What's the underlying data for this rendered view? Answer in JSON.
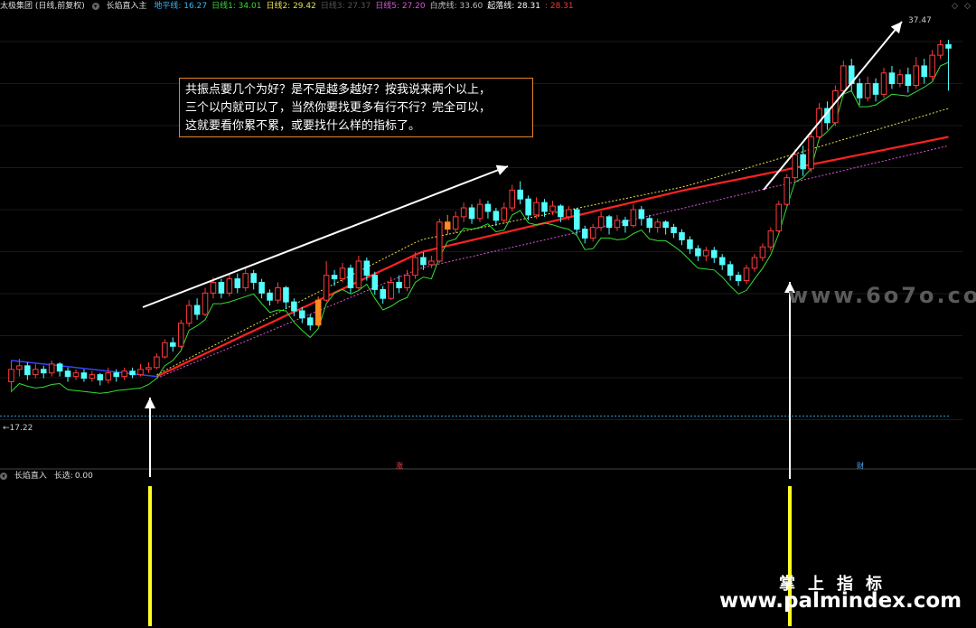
{
  "header": {
    "stock": "太极集团 (日线,前复权)",
    "indicator": "长焰直入主",
    "items": [
      {
        "label": "地平线:",
        "value": "16.27",
        "color": "#33b8ff"
      },
      {
        "label": "日线1:",
        "value": "34.01",
        "color": "#33dd33"
      },
      {
        "label": "日线2:",
        "value": "29.42",
        "color": "#e8e050"
      },
      {
        "label": "日线3:",
        "value": "27.37",
        "color": "#555555"
      },
      {
        "label": "日线5:",
        "value": "27.20",
        "color": "#dd55dd"
      },
      {
        "label": "白虎线:",
        "value": "33.60",
        "color": "#bbbbbb"
      },
      {
        "label": "起落线:",
        "value": "28.31",
        "color": "#ffffff"
      },
      {
        "label": ":",
        "value": "28.31",
        "color": "#ff3333"
      }
    ]
  },
  "sub_header": {
    "name": "长焰直入",
    "label": "长选:",
    "value": "0.00"
  },
  "annotation": {
    "lines": [
      "共振点要几个为好？是不是越多越好？按我说来两个以上，",
      "三个以内就可以了，当然你要找更多有行不行？完全可以，",
      "这就要看你累不累，或要找什么样的指标了。"
    ]
  },
  "price_labels": {
    "high": "37.47",
    "low": "17.22"
  },
  "markers": {
    "zhang": "涨",
    "cai": "财"
  },
  "watermarks": {
    "site_small": "www.6o7o.com",
    "brand": "掌上指标",
    "site": "www.palmindex.com"
  },
  "chart_data": {
    "type": "candlestick",
    "y_range": [
      14,
      39
    ],
    "reference_line": 16.27,
    "low_price": 17.22,
    "high_price": 37.47,
    "candles": [
      [
        18.2,
        18.9,
        19.4,
        17.6
      ],
      [
        18.9,
        19.1,
        19.5,
        18.5
      ],
      [
        19.1,
        18.6,
        19.3,
        18.3
      ],
      [
        18.6,
        18.9,
        19.2,
        18.4
      ],
      [
        18.9,
        18.7,
        19.1,
        18.4
      ],
      [
        18.7,
        19.2,
        19.4,
        18.5
      ],
      [
        19.2,
        18.8,
        19.3,
        18.5
      ],
      [
        18.8,
        18.5,
        19.0,
        18.2
      ],
      [
        18.5,
        18.7,
        18.9,
        18.3
      ],
      [
        18.7,
        18.4,
        18.9,
        18.2
      ],
      [
        18.4,
        18.6,
        18.8,
        18.2
      ],
      [
        18.6,
        18.3,
        18.7,
        18.0
      ],
      [
        18.3,
        18.7,
        19.0,
        18.1
      ],
      [
        18.7,
        18.5,
        18.9,
        18.2
      ],
      [
        18.5,
        18.8,
        19.0,
        18.3
      ],
      [
        18.8,
        18.6,
        19.0,
        18.4
      ],
      [
        18.6,
        18.9,
        19.2,
        18.5
      ],
      [
        18.9,
        19.0,
        19.3,
        18.7
      ],
      [
        19.0,
        19.6,
        19.8,
        18.9
      ],
      [
        19.6,
        20.4,
        20.6,
        19.5
      ],
      [
        20.4,
        20.2,
        20.7,
        19.9
      ],
      [
        20.2,
        21.5,
        21.7,
        20.1
      ],
      [
        21.5,
        22.5,
        22.8,
        21.3
      ],
      [
        22.5,
        22.0,
        22.9,
        21.7
      ],
      [
        22.0,
        23.2,
        23.5,
        21.9
      ],
      [
        23.2,
        23.8,
        24.1,
        22.9
      ],
      [
        23.8,
        23.2,
        24.0,
        22.9
      ],
      [
        23.2,
        24.0,
        24.3,
        23.0
      ],
      [
        24.0,
        23.5,
        24.3,
        23.2
      ],
      [
        23.5,
        24.3,
        24.6,
        23.3
      ],
      [
        24.3,
        23.8,
        24.5,
        23.4
      ],
      [
        23.8,
        23.2,
        24.0,
        22.9
      ],
      [
        23.2,
        22.8,
        23.4,
        22.5
      ],
      [
        22.8,
        23.5,
        23.8,
        22.6
      ],
      [
        23.5,
        22.7,
        23.6,
        22.3
      ],
      [
        22.7,
        22.2,
        22.9,
        21.9
      ],
      [
        22.2,
        21.8,
        22.4,
        21.5
      ],
      [
        21.8,
        21.4,
        22.0,
        21.1
      ],
      [
        21.4,
        22.8,
        23.0,
        21.3
      ],
      [
        22.8,
        24.2,
        25.0,
        22.7
      ],
      [
        24.2,
        24.0,
        24.5,
        23.6
      ],
      [
        24.0,
        24.6,
        24.9,
        23.8
      ],
      [
        24.6,
        23.5,
        24.8,
        23.2
      ],
      [
        23.5,
        25.0,
        25.3,
        23.4
      ],
      [
        25.0,
        24.2,
        25.2,
        23.9
      ],
      [
        24.2,
        23.4,
        24.4,
        23.1
      ],
      [
        23.4,
        22.9,
        23.6,
        22.6
      ],
      [
        22.9,
        23.8,
        24.1,
        22.8
      ],
      [
        23.8,
        23.5,
        24.2,
        23.2
      ],
      [
        23.5,
        24.2,
        24.5,
        23.3
      ],
      [
        24.2,
        25.2,
        25.5,
        24.0
      ],
      [
        25.2,
        24.8,
        25.5,
        24.5
      ],
      [
        24.8,
        25.0,
        25.3,
        24.6
      ],
      [
        25.0,
        27.2,
        27.4,
        24.9
      ],
      [
        27.2,
        26.8,
        27.6,
        26.5
      ],
      [
        26.8,
        27.5,
        27.8,
        26.6
      ],
      [
        27.5,
        28.0,
        28.3,
        27.2
      ],
      [
        28.0,
        27.4,
        28.2,
        27.1
      ],
      [
        27.4,
        28.2,
        28.5,
        27.2
      ],
      [
        28.2,
        27.8,
        28.4,
        27.4
      ],
      [
        27.8,
        27.3,
        28.0,
        27.0
      ],
      [
        27.3,
        28.0,
        28.3,
        27.1
      ],
      [
        28.0,
        29.0,
        29.3,
        27.8
      ],
      [
        29.0,
        28.5,
        29.5,
        28.2
      ],
      [
        28.5,
        27.6,
        28.7,
        27.3
      ],
      [
        27.6,
        28.3,
        28.6,
        27.4
      ],
      [
        28.3,
        27.8,
        28.5,
        27.5
      ],
      [
        27.8,
        28.1,
        28.4,
        27.6
      ],
      [
        28.1,
        27.5,
        28.2,
        27.2
      ],
      [
        27.5,
        27.9,
        28.1,
        27.3
      ],
      [
        27.9,
        26.8,
        28.0,
        26.5
      ],
      [
        26.8,
        26.3,
        27.0,
        26.0
      ],
      [
        26.3,
        26.9,
        27.1,
        26.1
      ],
      [
        26.9,
        27.5,
        27.8,
        26.7
      ],
      [
        27.5,
        26.9,
        27.6,
        26.5
      ],
      [
        26.9,
        27.3,
        27.6,
        26.7
      ],
      [
        27.3,
        27.0,
        27.5,
        26.6
      ],
      [
        27.0,
        27.9,
        28.2,
        26.9
      ],
      [
        27.9,
        27.4,
        28.1,
        27.0
      ],
      [
        27.4,
        26.9,
        27.6,
        26.6
      ],
      [
        26.9,
        27.2,
        27.4,
        26.6
      ],
      [
        27.2,
        26.9,
        27.3,
        26.5
      ],
      [
        26.9,
        26.6,
        27.1,
        26.3
      ],
      [
        26.6,
        26.2,
        26.8,
        25.9
      ],
      [
        26.2,
        25.7,
        26.4,
        25.4
      ],
      [
        25.7,
        25.3,
        25.9,
        25.0
      ],
      [
        25.3,
        25.6,
        25.8,
        25.0
      ],
      [
        25.6,
        25.2,
        25.8,
        24.9
      ],
      [
        25.2,
        24.8,
        25.4,
        24.5
      ],
      [
        24.8,
        24.2,
        25.0,
        23.9
      ],
      [
        24.2,
        23.9,
        24.4,
        23.6
      ],
      [
        23.9,
        24.6,
        24.8,
        23.7
      ],
      [
        24.6,
        25.2,
        25.4,
        24.4
      ],
      [
        25.2,
        25.8,
        26.0,
        25.0
      ],
      [
        25.8,
        26.7,
        26.9,
        25.6
      ],
      [
        26.7,
        28.2,
        28.4,
        26.6
      ],
      [
        28.2,
        29.7,
        29.9,
        28.1
      ],
      [
        29.7,
        31.0,
        31.3,
        29.5
      ],
      [
        31.0,
        30.2,
        31.5,
        29.8
      ],
      [
        30.2,
        32.0,
        32.3,
        30.0
      ],
      [
        32.0,
        33.6,
        33.9,
        31.8
      ],
      [
        33.6,
        32.8,
        34.0,
        32.4
      ],
      [
        32.8,
        34.6,
        34.9,
        32.6
      ],
      [
        34.6,
        36.0,
        36.3,
        34.3
      ],
      [
        36.0,
        35.0,
        36.4,
        34.6
      ],
      [
        35.0,
        34.2,
        35.3,
        33.8
      ],
      [
        34.2,
        35.0,
        35.4,
        34.0
      ],
      [
        35.0,
        34.4,
        35.3,
        34.0
      ],
      [
        34.4,
        35.6,
        35.9,
        34.2
      ],
      [
        35.6,
        35.0,
        36.0,
        34.7
      ],
      [
        35.0,
        35.5,
        35.8,
        34.8
      ],
      [
        35.5,
        34.9,
        35.9,
        34.5
      ],
      [
        34.9,
        36.0,
        36.5,
        34.7
      ],
      [
        36.0,
        35.4,
        36.4,
        35.0
      ],
      [
        35.4,
        36.6,
        36.9,
        35.2
      ],
      [
        36.6,
        37.2,
        37.47,
        36.4
      ],
      [
        37.2,
        37.0,
        37.47,
        34.6
      ]
    ],
    "series": [
      {
        "name": "起落线",
        "color": "#ff2222",
        "start_index": 18,
        "values": [
          18.5,
          25.5,
          29.0,
          32.0
        ]
      },
      {
        "name": "白虎线",
        "color": "#e8e050",
        "start_index": 18,
        "values": [
          18.6,
          26.2,
          29.2,
          33.6
        ]
      },
      {
        "name": "日线5",
        "color": "#dd55dd",
        "start_index": 18,
        "values": [
          18.4,
          24.6,
          28.0,
          31.5
        ]
      },
      {
        "name": "日线1",
        "color": "#33dd33",
        "start_index": 0,
        "values": [
          17.6,
          23.8,
          27.8,
          34.0
        ]
      }
    ],
    "signals": [
      {
        "index": 18,
        "label": "长选"
      },
      {
        "index": 107,
        "label": "长选"
      }
    ]
  }
}
